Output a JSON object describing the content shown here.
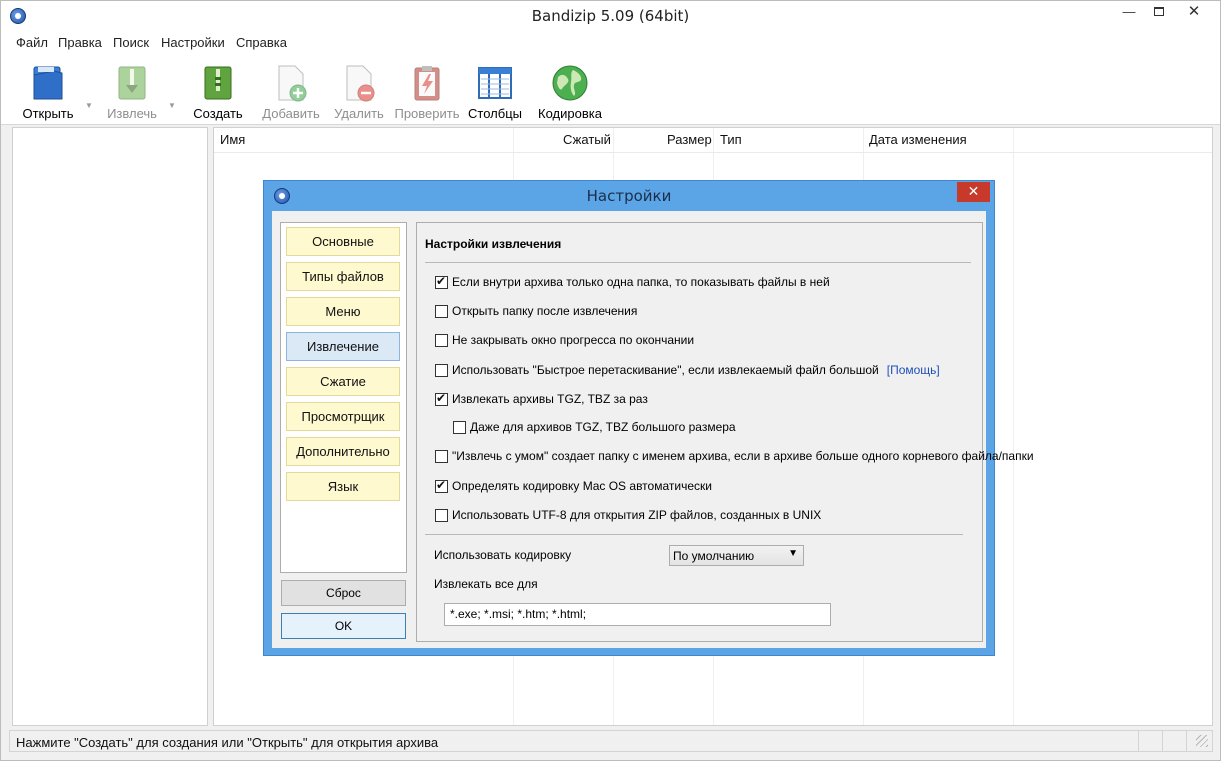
{
  "window": {
    "title": "Bandizip 5.09 (64bit)",
    "controls": {
      "minimize": "—",
      "close": "✕"
    }
  },
  "menu": [
    "Файл",
    "Правка",
    "Поиск",
    "Настройки",
    "Справка"
  ],
  "toolbar": [
    {
      "label": "Открыть",
      "icon": "open-archive-icon",
      "enabled": true
    },
    {
      "label": "Извлечь",
      "icon": "extract-icon",
      "enabled": false
    },
    {
      "label": "Создать",
      "icon": "create-archive-icon",
      "enabled": true
    },
    {
      "label": "Добавить",
      "icon": "add-file-icon",
      "enabled": false
    },
    {
      "label": "Удалить",
      "icon": "delete-file-icon",
      "enabled": false
    },
    {
      "label": "Проверить",
      "icon": "test-archive-icon",
      "enabled": false
    },
    {
      "label": "Столбцы",
      "icon": "columns-icon",
      "enabled": true
    },
    {
      "label": "Кодировка",
      "icon": "globe-icon",
      "enabled": true
    }
  ],
  "filelist": {
    "columns": [
      "Имя",
      "Сжатый",
      "Размер",
      "Тип",
      "Дата изменения"
    ]
  },
  "status": "Нажмите \"Создать\" для создания или \"Открыть\" для открытия архива",
  "dialog": {
    "title": "Настройки",
    "close": "✕",
    "nav": [
      "Основные",
      "Типы файлов",
      "Меню",
      "Извлечение",
      "Сжатие",
      "Просмотрщик",
      "Дополнительно",
      "Язык"
    ],
    "active_nav": "Извлечение",
    "reset_label": "Сброс",
    "ok_label": "OK",
    "panel_title": "Настройки извлечения",
    "options": [
      {
        "label": "Если внутри архива только одна папка, то показывать файлы в ней",
        "checked": true,
        "indent": 0
      },
      {
        "label": "Открыть папку после извлечения",
        "checked": false,
        "indent": 0
      },
      {
        "label": "Не закрывать окно прогресса по окончании",
        "checked": false,
        "indent": 0
      },
      {
        "label": "Использовать \"Быстрое перетаскивание\", если извлекаемый файл большой",
        "checked": false,
        "indent": 0,
        "link": "[Помощь]"
      },
      {
        "label": "Извлекать архивы TGZ, TBZ за раз",
        "checked": true,
        "indent": 0
      },
      {
        "label": "Даже для архивов TGZ, TBZ большого размера",
        "checked": false,
        "indent": 1
      },
      {
        "label": "\"Извлечь с умом\" создает папку с именем архива, если в архиве больше одного корневого файла/папки",
        "checked": false,
        "indent": 0
      },
      {
        "label": "Определять кодировку Mac OS автоматически",
        "checked": true,
        "indent": 0
      },
      {
        "label": "Использовать UTF-8 для открытия ZIP файлов, созданных в UNIX",
        "checked": false,
        "indent": 0
      }
    ],
    "encoding_label": "Использовать кодировку",
    "encoding_value": "По умолчанию",
    "extract_all_label": "Извлекать все для",
    "extract_all_value": "*.exe; *.msi; *.htm; *.html;"
  }
}
